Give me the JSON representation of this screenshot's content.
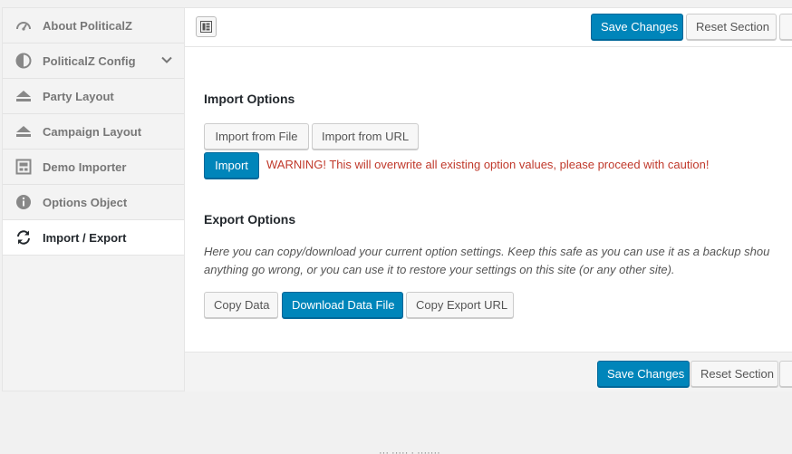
{
  "sidebar": {
    "items": [
      {
        "label": "About PoliticalZ",
        "icon": "dashboard-icon"
      },
      {
        "label": "PoliticalZ Config",
        "icon": "half-circle-icon"
      },
      {
        "label": "Party Layout",
        "icon": "eject-icon"
      },
      {
        "label": "Campaign Layout",
        "icon": "eject-icon"
      },
      {
        "label": "Demo Importer",
        "icon": "importer-icon"
      },
      {
        "label": "Options Object",
        "icon": "info-icon"
      },
      {
        "label": "Import / Export",
        "icon": "refresh-icon"
      }
    ]
  },
  "toolbar": {
    "save_label": "Save Changes",
    "reset_section_label": "Reset Section",
    "reset_all_label": "R"
  },
  "import_section": {
    "title": "Import Options",
    "from_file_label": "Import from File",
    "from_url_label": "Import from URL",
    "import_label": "Import",
    "warning": "WARNING! This will overwrite all existing option values, please proceed with caution!"
  },
  "export_section": {
    "title": "Export Options",
    "description_line1": "Here you can copy/download your current option settings. Keep this safe as you can use it as a backup shou",
    "description_line2": "anything go wrong, or you can use it to restore your settings on this site (or any other site).",
    "copy_data_label": "Copy Data",
    "download_label": "Download Data File",
    "copy_url_label": "Copy Export URL"
  },
  "footer": {
    "save_label": "Save Changes",
    "reset_section_label": "Reset Section",
    "reset_all_label": "R"
  },
  "below_panel_text": "··· ····· · ·······",
  "colors": {
    "primary": "#0085ba",
    "warning": "#c0392b",
    "sidebar_bg": "#f3f3f3"
  }
}
